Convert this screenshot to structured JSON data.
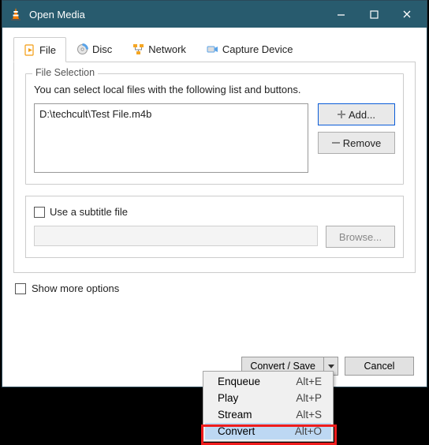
{
  "title": "Open Media",
  "tabs": {
    "file": "File",
    "disc": "Disc",
    "network": "Network",
    "capture": "Capture Device"
  },
  "file_selection": {
    "legend": "File Selection",
    "hint": "You can select local files with the following list and buttons.",
    "items": [
      "D:\\techcult\\Test File.m4b"
    ],
    "add": "Add...",
    "remove": "Remove"
  },
  "subtitle": {
    "checkbox": "Use a subtitle file",
    "browse": "Browse..."
  },
  "more_options": "Show more options",
  "buttons": {
    "convert_save": "Convert / Save",
    "cancel": "Cancel"
  },
  "dropdown": [
    {
      "label": "Enqueue",
      "shortcut": "Alt+E"
    },
    {
      "label": "Play",
      "shortcut": "Alt+P"
    },
    {
      "label": "Stream",
      "shortcut": "Alt+S"
    },
    {
      "label": "Convert",
      "shortcut": "Alt+O",
      "selected": true
    }
  ]
}
